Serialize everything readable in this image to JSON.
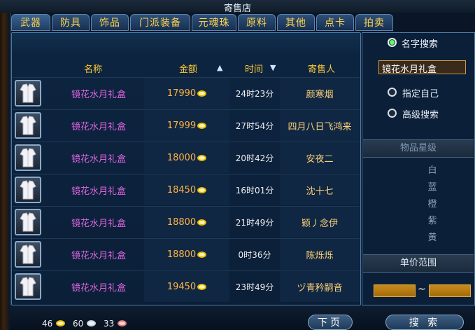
{
  "window": {
    "title": "寄售店"
  },
  "tabs": [
    "武器",
    "防具",
    "饰品",
    "门派装备",
    "元魂珠",
    "原料",
    "其他",
    "点卡",
    "拍卖"
  ],
  "table": {
    "headers": {
      "name": "名称",
      "price": "金额",
      "time": "时间",
      "seller": "寄售人"
    },
    "sort_price_arrow": "▲",
    "sort_time_arrow": "▼",
    "rows": [
      {
        "name": "镜花水月礼盒",
        "price": "17990",
        "time": "24时23分",
        "seller": "颜寒烟"
      },
      {
        "name": "镜花水月礼盒",
        "price": "17999",
        "time": "27时54分",
        "seller": "四月八日飞鸿来"
      },
      {
        "name": "镜花水月礼盒",
        "price": "18000",
        "time": "20时42分",
        "seller": "安夜二"
      },
      {
        "name": "镜花水月礼盒",
        "price": "18450",
        "time": "16时01分",
        "seller": "沈十七"
      },
      {
        "name": "镜花水月礼盒",
        "price": "18800",
        "time": "21时49分",
        "seller": "颖丿念伊"
      },
      {
        "name": "镜花水月礼盒",
        "price": "18800",
        "time": "0时36分",
        "seller": "陈烁烁"
      },
      {
        "name": "镜花水月礼盒",
        "price": "19450",
        "time": "23时49分",
        "seller": "ヅ青矜嗣音"
      }
    ]
  },
  "search": {
    "option_name": "名字搜索",
    "name_value": "镜花水月礼盒",
    "option_self": "指定自己",
    "option_advanced": "高级搜索",
    "selected": "名字搜索"
  },
  "filters": {
    "quality_title": "物品星级",
    "qualities": [
      "白",
      "蓝",
      "橙",
      "紫",
      "黄"
    ],
    "price_range_title": "单价范围",
    "range_separator": "~"
  },
  "buttons": {
    "next_page": "下页",
    "search": "搜 索"
  },
  "currency": {
    "gold": "46",
    "silver": "60",
    "copper": "33"
  },
  "colors": {
    "item_name": "#e066e0",
    "price": "#ffb347",
    "tab_text": "#ffd24d",
    "header": "#ffcc33"
  }
}
